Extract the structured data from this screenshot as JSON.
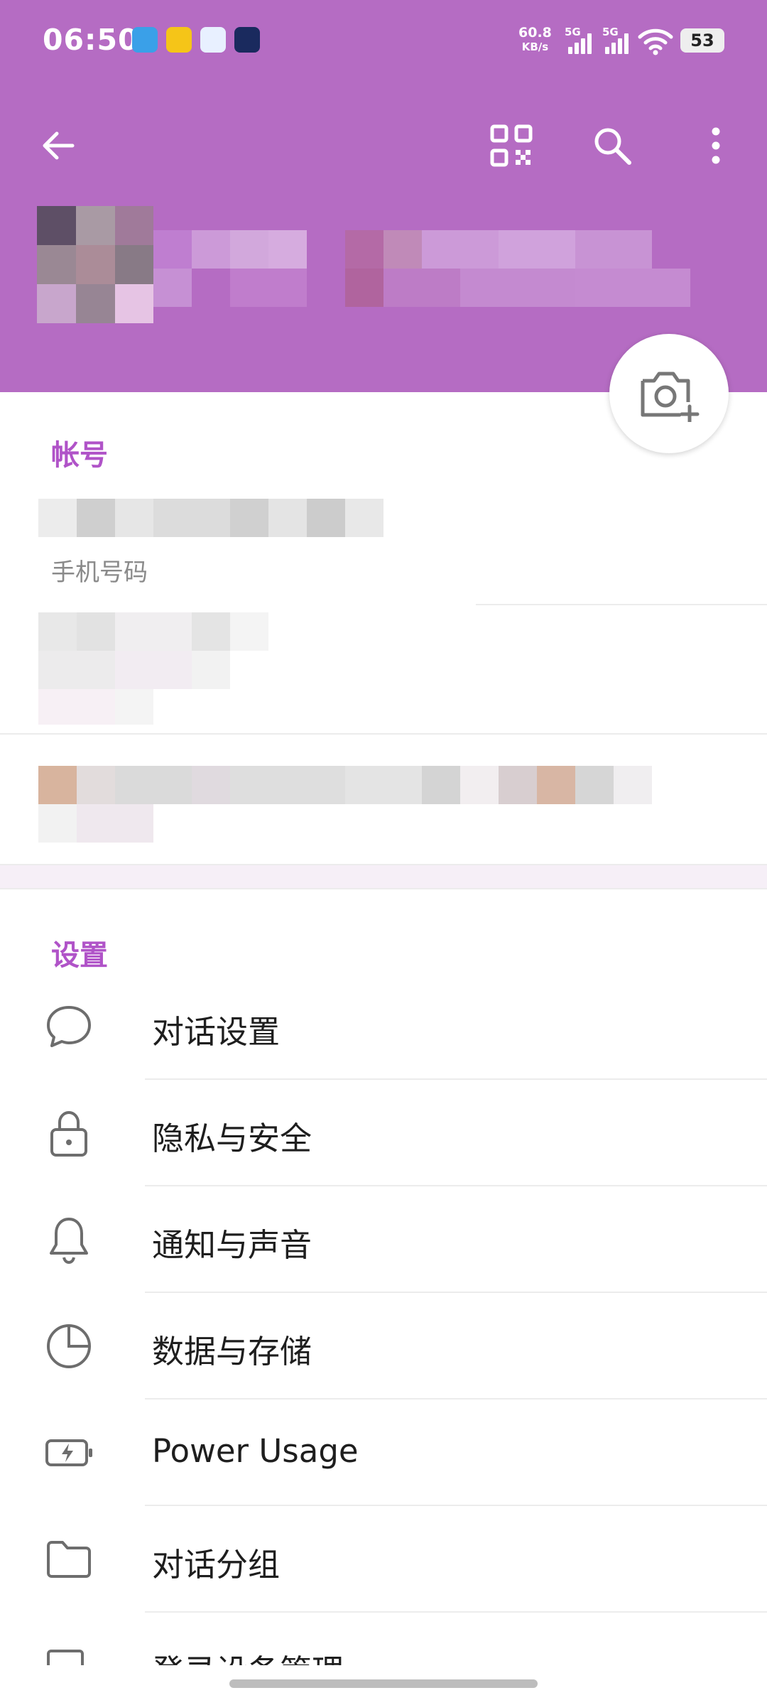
{
  "status_bar": {
    "time": "06:50",
    "net_speed_value": "60.8",
    "net_speed_unit": "KB/s",
    "sim1": "5G",
    "sim2": "5G",
    "battery": "53"
  },
  "app_bar": {
    "back_icon": "arrow-left-icon",
    "qr_icon": "qr-code-icon",
    "search_icon": "search-icon",
    "more_icon": "more-vertical-icon"
  },
  "account": {
    "section_title": "帐号",
    "phone_label": "手机号码"
  },
  "settings": {
    "section_title": "设置",
    "items": [
      {
        "label": "对话设置",
        "icon": "chat-bubble-icon"
      },
      {
        "label": "隐私与安全",
        "icon": "lock-icon"
      },
      {
        "label": "通知与声音",
        "icon": "bell-icon"
      },
      {
        "label": "数据与存储",
        "icon": "pie-clock-icon"
      },
      {
        "label": "Power Usage",
        "icon": "battery-bolt-icon"
      },
      {
        "label": "对话分组",
        "icon": "folder-icon"
      },
      {
        "label": "登录设备管理",
        "icon": "devices-icon"
      }
    ]
  },
  "colors": {
    "header": "#b56cc3",
    "accent": "#b053c8"
  }
}
